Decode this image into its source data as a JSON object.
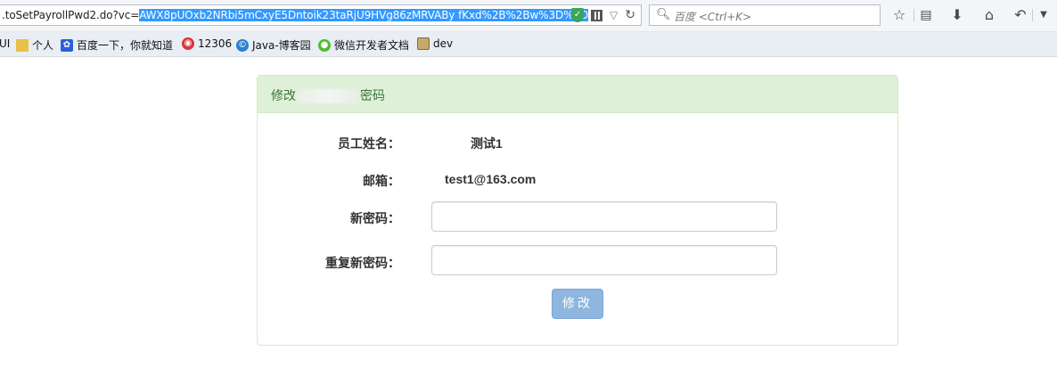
{
  "browser": {
    "url_prefix": ".toSetPayrollPwd2.do?vc=",
    "url_selected": "AWX8pUOxb2NRbi5mCxyE5Dntoik23taRjU9HVg86zMRVABy fKxd%2B%2Bw%3D%3D",
    "search_placeholder": "百度 <Ctrl+K>"
  },
  "bookmarks": [
    {
      "label": "UI",
      "icon": "folder-icon"
    },
    {
      "label": "个人",
      "icon": "folder-icon"
    },
    {
      "label": "百度一下，你就知道",
      "icon": "baidu-icon"
    },
    {
      "label": "12306",
      "icon": "12306-icon"
    },
    {
      "label": "Java-博客园",
      "icon": "cnblogs-icon"
    },
    {
      "label": "微信开发者文档",
      "icon": "wechat-icon"
    },
    {
      "label": "dev",
      "icon": "image-icon"
    }
  ],
  "form": {
    "title_prefix": "修改",
    "title_suffix": "密码",
    "employee_name_label": "员工姓名：",
    "employee_name_value": "测试1",
    "email_label": "邮箱：",
    "email_value": "test1@163.com",
    "new_password_label": "新密码：",
    "new_password_value": "",
    "repeat_password_label": "重复新密码：",
    "repeat_password_value": "",
    "submit_label": "修改"
  },
  "colors": {
    "panel_heading_bg": "#dff0d8",
    "panel_heading_text": "#3c763d",
    "submit_bg": "#8fb6de"
  }
}
